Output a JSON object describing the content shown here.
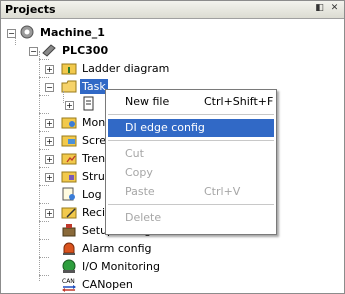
{
  "panel": {
    "title": "Projects"
  },
  "tree": {
    "root": "Machine_1",
    "plc": "PLC300",
    "items": [
      "Ladder diagram",
      "Task",
      "Mon",
      "Scre",
      "Tren",
      "Stru",
      "Log",
      "Reci",
      "Setup configuration",
      "Alarm config",
      "I/O Monitoring",
      "CANopen"
    ]
  },
  "context_menu": {
    "items": [
      {
        "label": "New file",
        "shortcut": "Ctrl+Shift+F",
        "state": "enabled"
      },
      {
        "label": "DI edge config",
        "shortcut": "",
        "state": "highlighted"
      },
      {
        "label": "Cut",
        "shortcut": "",
        "state": "disabled"
      },
      {
        "label": "Copy",
        "shortcut": "",
        "state": "disabled"
      },
      {
        "label": "Paste",
        "shortcut": "Ctrl+V",
        "state": "disabled"
      },
      {
        "label": "Delete",
        "shortcut": "",
        "state": "disabled"
      }
    ]
  },
  "colors": {
    "selection": "#3169c6",
    "disabled_text": "#a6a6a6"
  }
}
